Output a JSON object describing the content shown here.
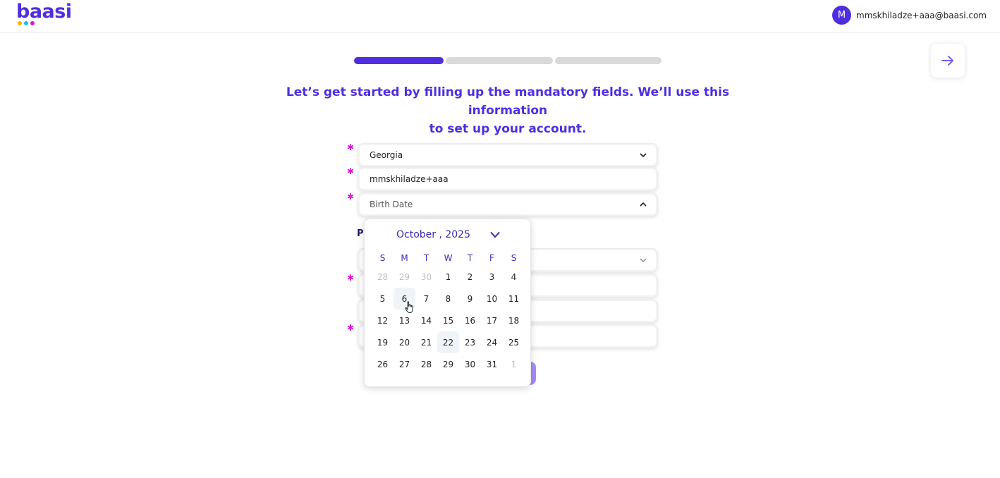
{
  "brand": {
    "name": "baasi",
    "colors": {
      "primary": "#4f2ee0",
      "dot1": "#f5b400",
      "dot2": "#19c0e8",
      "dot3": "#d21bd0"
    }
  },
  "user": {
    "avatar_initial": "M",
    "email": "mmskhiladze+aaa@baasi.com"
  },
  "progress": {
    "current_step": 1,
    "total_steps": 3
  },
  "headline": {
    "line1": "Let’s get started by filling up the mandatory fields. We’ll use this information",
    "line2": "to set up your account."
  },
  "form": {
    "required_marker": "✱",
    "country_value": "Georgia",
    "username_value": "mmskhiladze+aaa",
    "birth_date_placeholder": "Birth Date",
    "section_label_peek": "P"
  },
  "calendar": {
    "month_label": "October , 2025",
    "weekdays": [
      "S",
      "M",
      "T",
      "W",
      "T",
      "F",
      "S"
    ],
    "weeks": [
      [
        "28",
        "29",
        "30",
        "1",
        "2",
        "3",
        "4"
      ],
      [
        "5",
        "6",
        "7",
        "8",
        "9",
        "10",
        "11"
      ],
      [
        "12",
        "13",
        "14",
        "15",
        "16",
        "17",
        "18"
      ],
      [
        "19",
        "20",
        "21",
        "22",
        "23",
        "24",
        "25"
      ],
      [
        "26",
        "27",
        "28",
        "29",
        "30",
        "31",
        "1"
      ]
    ],
    "hovered_day": "6",
    "today": "22"
  },
  "icons": {
    "next": "arrow-right-icon",
    "dropdown": "chevron-down-icon",
    "collapse": "chevron-up-icon"
  }
}
